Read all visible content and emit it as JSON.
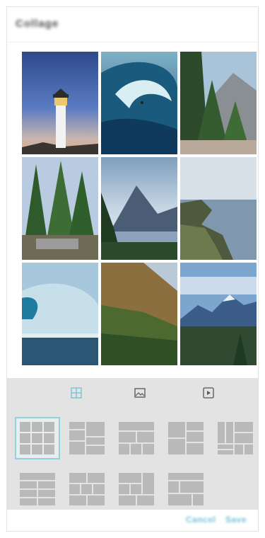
{
  "header": {
    "title": "Collage"
  },
  "collage": {
    "photos": [
      {
        "name": "lighthouse"
      },
      {
        "name": "wave-surfer"
      },
      {
        "name": "forest-mountain"
      },
      {
        "name": "pine-forest"
      },
      {
        "name": "mountain-lake"
      },
      {
        "name": "coastline"
      },
      {
        "name": "ocean-wave"
      },
      {
        "name": "hillside"
      },
      {
        "name": "mountain-range"
      }
    ]
  },
  "tabs": [
    {
      "name": "layout-tab",
      "icon": "grid-icon",
      "selected": true
    },
    {
      "name": "background-tab",
      "icon": "image-icon",
      "selected": false
    },
    {
      "name": "ratio-tab",
      "icon": "play-box-icon",
      "selected": false
    }
  ],
  "layout_options": {
    "count": 9,
    "selected_index": 0
  },
  "footer": {
    "cancel_label": "Cancel",
    "save_label": "Save"
  },
  "colors": {
    "accent": "#6fc3d6",
    "panel": "#e3e3e3",
    "tile": "#b9b9b9"
  }
}
